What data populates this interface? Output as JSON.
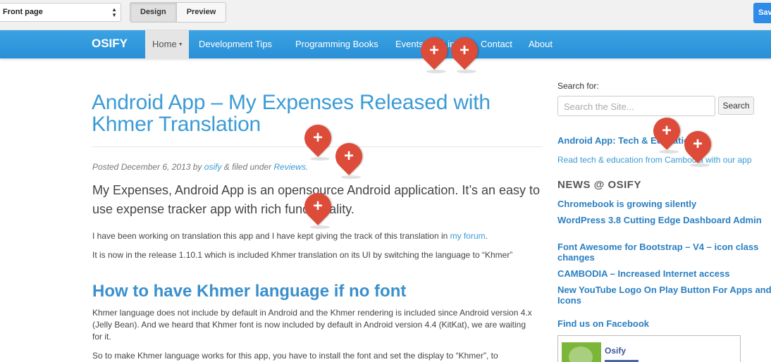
{
  "toolbar": {
    "page_select": "Front page",
    "design_label": "Design",
    "preview_label": "Preview",
    "save_label": "Save"
  },
  "nav": {
    "brand": "OSIFY",
    "items": [
      {
        "label": "Home"
      },
      {
        "label": "Development Tips"
      },
      {
        "label": "Programming Books"
      },
      {
        "label": "Events"
      },
      {
        "label": "Links"
      },
      {
        "label": "Contact"
      },
      {
        "label": "About"
      }
    ]
  },
  "post": {
    "title": "Android App – My Expenses Released with Khmer Translation",
    "meta_prefix": "Posted December 6, 2013 by ",
    "author": "osify",
    "meta_mid": " & filed under ",
    "category": "Reviews",
    "meta_suffix": ".",
    "lead": "My Expenses, Android App is an opensource Android application. It’s an easy to use expense tracker app with rich functionality.",
    "p1_text": "I have been working on translation this app and I have kept giving the track of this translation in ",
    "p1_link": "my forum",
    "p1_end": ".",
    "p2": "It is now in the release 1.10.1 which is included Khmer translation on its UI by switching the language to “Khmer”",
    "h2": "How to have Khmer language if no font",
    "p3": "Khmer language does not include by default in Android and the Khmer rendering is included since Android version 4.x (Jelly Bean). And we heard that Khmer font is now included by default in Android version 4.4 (KitKat), we are waiting for it.",
    "p4": "So to make Khmer language works for this app, you have to install the font and set the display to “Khmer”, to"
  },
  "sidebar": {
    "search_label": "Search for:",
    "search_placeholder": "Search the Site...",
    "search_button": "Search",
    "promo_title": "Android App: Tech & Education",
    "promo_sub": "Read tech & education from Cambodia with our app",
    "news_heading": "NEWS @ OSIFY",
    "news": [
      "Chromebook is growing silently",
      "WordPress 3.8 Cutting Edge Dashboard Admin",
      "Font Awesome for Bootstrap – V4 – icon class changes",
      "CAMBODIA – Increased Internet access",
      "New YouTube Logo On Play Button For Apps and Icons"
    ],
    "facebook_heading": "Find us on Facebook",
    "fb_name": "Osify"
  },
  "pins": {
    "icon": "plus-icon",
    "symbol": "+",
    "color": "#dd4b39"
  }
}
